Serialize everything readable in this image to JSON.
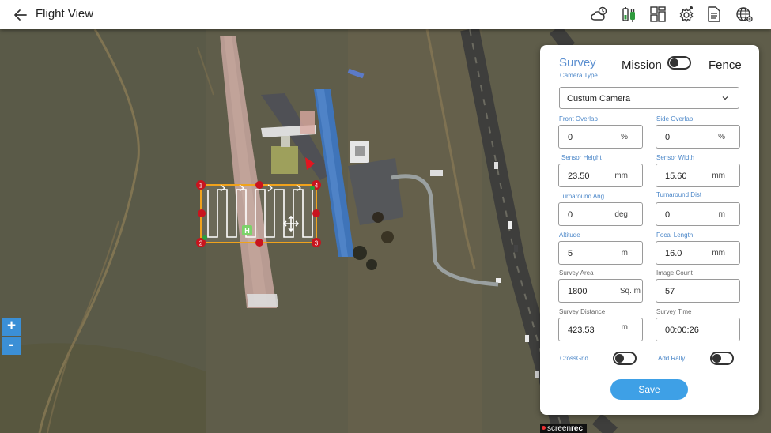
{
  "header": {
    "title": "Flight View"
  },
  "toolbar": {
    "icons": [
      "weather-cloud-icon",
      "battery-plug-icon",
      "dashboard-layout-icon",
      "settings-gear-icon",
      "document-icon",
      "globe-network-icon"
    ]
  },
  "map": {
    "zoom_in_label": "+",
    "zoom_out_label": "-",
    "waypoints": [
      "1",
      "2",
      "3",
      "4"
    ],
    "home_label": "H",
    "watermark_prefix": "screen",
    "watermark_suffix": "rec"
  },
  "survey_panel": {
    "tab_survey": "Survey",
    "tab_mission": "Mission",
    "tab_fence": "Fence",
    "camera_type_label": "Camera Type",
    "camera_type_value": "Custum Camera",
    "front_overlap": {
      "label": "Front Overlap",
      "value": "0",
      "unit": "%"
    },
    "side_overlap": {
      "label": "Side Overlap",
      "value": "0",
      "unit": "%"
    },
    "sensor_height": {
      "label": "Sensor Height",
      "value": "23.50",
      "unit": "mm"
    },
    "sensor_width": {
      "label": "Sensor Width",
      "value": "15.60",
      "unit": "mm"
    },
    "turnaround_ang": {
      "label": "Turnaround Ang",
      "value": "0",
      "unit": "deg"
    },
    "turnaround_dist": {
      "label": "Turnaround Dist",
      "value": "0",
      "unit": "m"
    },
    "altitude": {
      "label": "Altitude",
      "value": "5",
      "unit": "m"
    },
    "focal_length": {
      "label": "Focal Length",
      "value": "16.0",
      "unit": "mm"
    },
    "survey_area": {
      "label": "Survey Area",
      "value": "1800",
      "unit": "Sq. m"
    },
    "image_count": {
      "label": "Image Count",
      "value": "57"
    },
    "survey_distance": {
      "label": "Survey Distance",
      "value": "423.53",
      "unit": "m"
    },
    "survey_time": {
      "label": "Survey Time",
      "value": "00:00:26"
    },
    "crossgrid_label": "CrossGrid",
    "add_rally_label": "Add Rally",
    "save_label": "Save"
  },
  "colors": {
    "accent_blue": "#5b8fd0",
    "save_button": "#3ea0e6",
    "zoom_button": "#3b8fd6",
    "survey_outline": "#f0a21c",
    "waypoint_red": "#c8141e",
    "home_green": "#7cd36a"
  }
}
